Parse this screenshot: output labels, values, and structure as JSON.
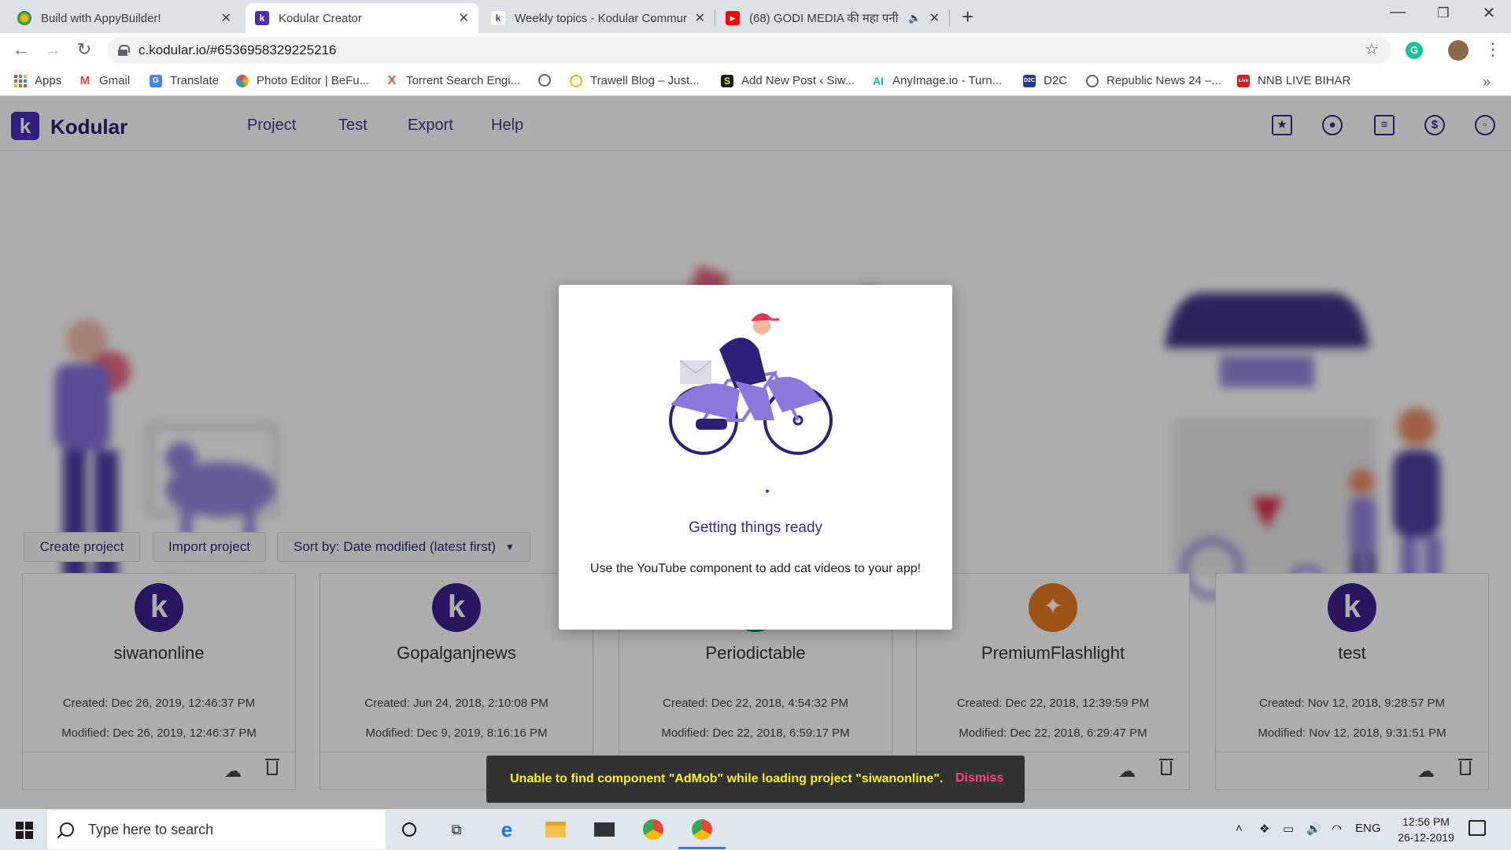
{
  "browser": {
    "tabs": [
      {
        "title": "Build with AppyBuilder!",
        "active": false,
        "favicon": "appybuilder-icon"
      },
      {
        "title": "Kodular Creator",
        "active": true,
        "favicon": "kodular-icon"
      },
      {
        "title": "Weekly topics - Kodular Commur",
        "active": false,
        "favicon": "kodular-community-icon"
      },
      {
        "title": "(68) GODI MEDIA की महा पनी",
        "active": false,
        "favicon": "youtube-icon"
      }
    ],
    "url": "c.kodular.io/#6536958329225216",
    "bookmarks": [
      {
        "label": "Apps",
        "icon": "apps-grid-icon"
      },
      {
        "label": "Gmail",
        "icon": "gmail-icon"
      },
      {
        "label": "Translate",
        "icon": "translate-icon"
      },
      {
        "label": "Photo Editor | BeFu...",
        "icon": "befunky-icon"
      },
      {
        "label": "Torrent Search Engi...",
        "icon": "torrent-icon"
      },
      {
        "label": "",
        "icon": "globe-icon"
      },
      {
        "label": "Trawell Blog – Just...",
        "icon": "trawell-icon"
      },
      {
        "label": "Add New Post ‹ Siw...",
        "icon": "wordpress-icon"
      },
      {
        "label": "AnyImage.io - Turn...",
        "icon": "anyimage-icon"
      },
      {
        "label": "D2C",
        "icon": "d2c-icon"
      },
      {
        "label": "Republic News 24 –...",
        "icon": "globe-icon"
      },
      {
        "label": "NNB LIVE BIHAR",
        "icon": "nnb-icon"
      }
    ]
  },
  "app": {
    "brand": "Kodular",
    "logo_letter": "k",
    "menu": [
      "Project",
      "Test",
      "Export",
      "Help"
    ],
    "toolbar_icons": [
      "folder-star-icon",
      "palette-icon",
      "library-icon",
      "dollar-icon",
      "account-icon"
    ],
    "buttons": {
      "create": "Create project",
      "import": "Import project",
      "sort": "Sort by: Date modified (latest first)"
    },
    "projects": [
      {
        "name": "siwanonline",
        "created": "Created: Dec 26, 2019, 12:46:37 PM",
        "modified": "Modified: Dec 26, 2019, 12:46:37 PM",
        "icon": "kodular-icon"
      },
      {
        "name": "Gopalganjnews",
        "created": "Created: Jun 24, 2018, 2:10:08 PM",
        "modified": "Modified: Dec 9, 2019, 8:16:16 PM",
        "icon": "kodular-icon"
      },
      {
        "name": "Periodictable",
        "created": "Created: Dec 22, 2018, 4:54:32 PM",
        "modified": "Modified: Dec 22, 2018, 6:59:17 PM",
        "icon": "periodic-icon"
      },
      {
        "name": "PremiumFlashlight",
        "created": "Created: Dec 22, 2018, 12:39:59 PM",
        "modified": "Modified: Dec 22, 2018, 6:29:47 PM",
        "icon": "flashlight-icon"
      },
      {
        "name": "test",
        "created": "Created: Nov 12, 2018, 9:28:57 PM",
        "modified": "Modified: Nov 12, 2018, 9:31:51 PM",
        "icon": "kodular-icon"
      }
    ]
  },
  "modal": {
    "title": "Getting things ready",
    "tip": "Use the YouTube component to add cat videos to your app!"
  },
  "snackbar": {
    "message": "Unable to find component \"AdMob\" while loading project \"siwanonline\".",
    "action": "Dismiss"
  },
  "taskbar": {
    "search_placeholder": "Type here to search",
    "lang": "ENG",
    "time": "12:56 PM",
    "date": "26-12-2019"
  },
  "colors": {
    "brand": "#4a2eb5",
    "snack_text": "#f6f21a",
    "snack_action": "#ff4081"
  }
}
